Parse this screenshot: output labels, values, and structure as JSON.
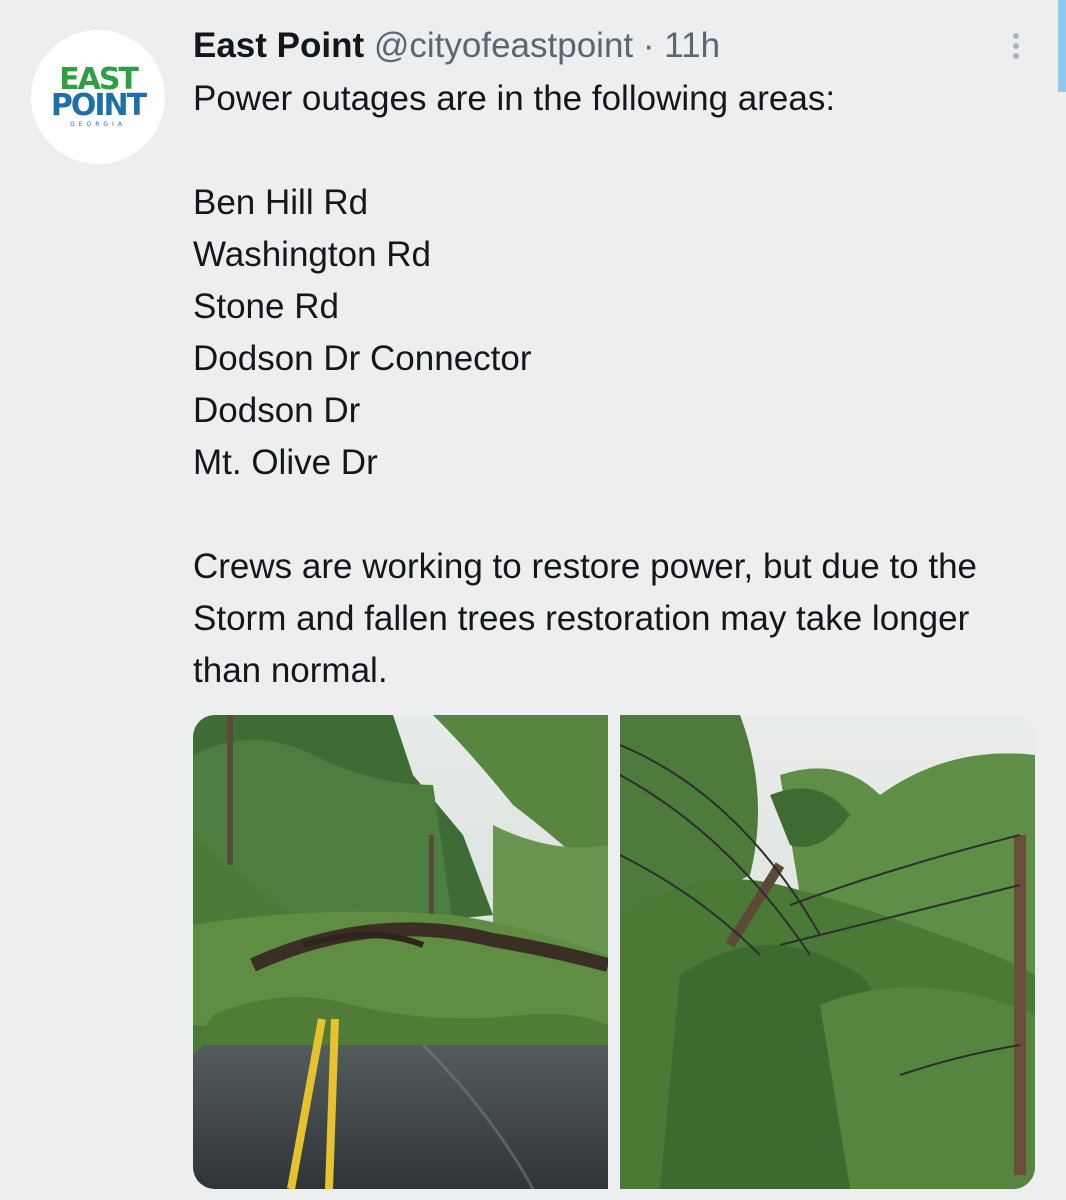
{
  "tweet": {
    "author": {
      "display_name": "East Point",
      "handle": "@cityofeastpoint",
      "avatar_logo": {
        "line1": "EAST",
        "line2": "POINT",
        "line3": "GEORGIA"
      }
    },
    "time_separator": "·",
    "time": "11h",
    "intro": "Power outages are in the following areas:",
    "streets": [
      "Ben Hill Rd",
      "Washington Rd",
      "Stone Rd",
      "Dodson Dr Connector",
      "Dodson Dr",
      "Mt. Olive Dr"
    ],
    "closing": "Crews are working to restore power, but due to the Storm and fallen trees restoration may take longer than normal.",
    "media": [
      {
        "icon": "photo-fallen-tree-road"
      },
      {
        "icon": "photo-leaning-utility-pole"
      }
    ]
  },
  "colors": {
    "background": "#eceef0",
    "text": "#14171a",
    "secondary_text": "#5b6670",
    "logo_green": "#2f9e44",
    "logo_blue": "#1f6fa8",
    "accent": "#8fc8ef"
  }
}
